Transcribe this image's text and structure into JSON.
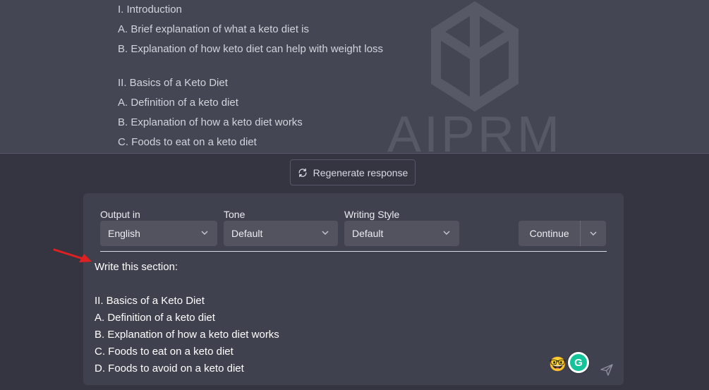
{
  "chat": {
    "watermark": "AIPRM",
    "outline": [
      "I. Introduction",
      "A. Brief explanation of what a keto diet is",
      "B. Explanation of how keto diet can help with weight loss",
      "II. Basics of a Keto Diet",
      "A. Definition of a keto diet",
      "B. Explanation of how a keto diet works",
      "C. Foods to eat on a keto diet"
    ]
  },
  "regenerate": {
    "label": "Regenerate response",
    "icon": "refresh-icon"
  },
  "prompt_panel": {
    "output_in": {
      "label": "Output in",
      "value": "English"
    },
    "tone": {
      "label": "Tone",
      "value": "Default"
    },
    "writing_style": {
      "label": "Writing Style",
      "value": "Default"
    },
    "continue_label": "Continue",
    "prompt_lines": [
      "Write this section:",
      "",
      "II. Basics of a Keto Diet",
      "A. Definition of a keto diet",
      "B. Explanation of how a keto diet works",
      "C. Foods to eat on a keto diet",
      "D. Foods to avoid on a keto diet"
    ],
    "emoji": "🤓",
    "grammarly_letter": "G"
  },
  "colors": {
    "background": "#343541",
    "chat_background": "#444654",
    "panel_background": "#40414f",
    "annotation_arrow": "#e02020",
    "grammarly": "#15c39a"
  }
}
